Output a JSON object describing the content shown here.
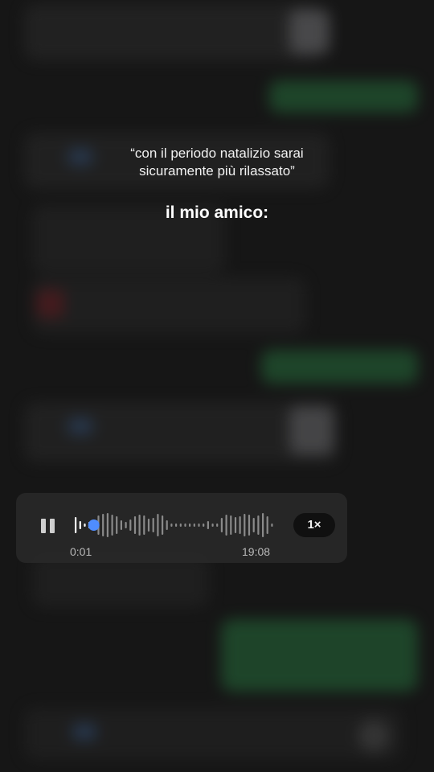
{
  "quote": {
    "line1": "“con il periodo natalizio sarai",
    "line2": "sicuramente più rilassato”"
  },
  "subtitle": "il mio amico:",
  "voice_message": {
    "current_time": "0:01",
    "total_time": "19:08",
    "speed": "1×",
    "progress": 0.09,
    "played_color": "#ffffff",
    "unplayed_color": "#8a8a8a",
    "handle_color": "#4f8dff"
  },
  "colors": {
    "background": "#161616",
    "bubble_green": "#1f4a2c"
  }
}
